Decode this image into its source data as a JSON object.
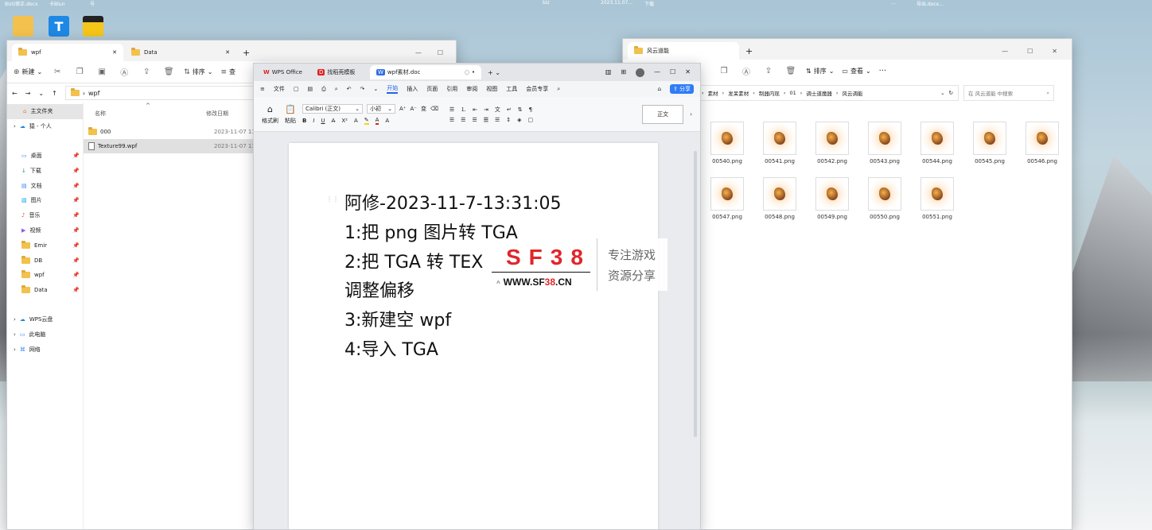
{
  "desktop": {
    "icons": [
      {
        "name": "folder",
        "color": "#f2c14e"
      },
      {
        "name": "T",
        "color": "#1e88e5"
      },
      {
        "name": "app",
        "color": "#f5c518"
      }
    ],
    "top_labels": [
      "BUG修正.docx",
      "卡Blun",
      "号",
      "biz",
      "2023.11.07...",
      "下载",
      "...",
      "导出.docx..."
    ]
  },
  "explorer_left": {
    "tabs": [
      {
        "label": "wpf"
      },
      {
        "label": "Data"
      }
    ],
    "new_tab": "+",
    "toolbar": {
      "new": "新建",
      "sort": "排序",
      "view": "查"
    },
    "path": "wpf",
    "sidebar": {
      "home": "主文件夹",
      "onedrive": "猿 - 个人",
      "quick": [
        {
          "label": "桌面",
          "icon": "desktop-icon"
        },
        {
          "label": "下载",
          "icon": "download-icon"
        },
        {
          "label": "文档",
          "icon": "document-icon"
        },
        {
          "label": "图片",
          "icon": "picture-icon"
        },
        {
          "label": "音乐",
          "icon": "music-icon"
        },
        {
          "label": "视频",
          "icon": "video-icon"
        },
        {
          "label": "Emir",
          "icon": "folder-icon"
        },
        {
          "label": "DB",
          "icon": "folder-icon"
        },
        {
          "label": "wpf",
          "icon": "folder-icon"
        },
        {
          "label": "Data",
          "icon": "folder-icon"
        }
      ],
      "locations": [
        {
          "label": "WPS云盘"
        },
        {
          "label": "此电脑"
        },
        {
          "label": "网络"
        }
      ]
    },
    "columns": {
      "name": "名称",
      "date": "修改日期"
    },
    "files": [
      {
        "name": "000",
        "date": "2023-11-07 13:3"
      },
      {
        "name": "Texture99.wpf",
        "date": "2023-11-07 13:2"
      }
    ]
  },
  "wps": {
    "tabs": [
      {
        "label": "WPS Office"
      },
      {
        "label": "找稻壳模板"
      },
      {
        "label": "wpf素材.doc"
      }
    ],
    "menu": [
      "文件",
      "开始",
      "插入",
      "页面",
      "引用",
      "审阅",
      "视图",
      "工具",
      "会员专享"
    ],
    "menu_active": "开始",
    "share": "分享",
    "ribbon": {
      "format_painter": "格式刷",
      "paste": "粘贴",
      "font": "Calibri (正文)",
      "size": "小初",
      "style_sample": "正文"
    },
    "doc_lines": [
      "阿修-2023-11-7-13:31:05",
      "1:把 png 图片转 TGA",
      "2:把 TGA 转 TEX",
      "调整偏移",
      "3:新建空 wpf",
      "4:导入 TGA"
    ],
    "watermark": {
      "brand": "SF38",
      "url_prefix": "WWW.SF",
      "url_num": "38",
      "url_suffix": ".CN",
      "slogan1": "专注游戏",
      "slogan2": "资源分享"
    }
  },
  "explorer_right": {
    "tab": "风云道能",
    "new_tab": "+",
    "toolbar": {
      "sort": "排序",
      "view": "查看"
    },
    "breadcrumb": [
      "素材",
      "发呆素材",
      "制器内现",
      "01",
      "调士道魔器",
      "风云调能"
    ],
    "search_placeholder": "在 风云道能 中搜索",
    "files": [
      {
        "name": "00540.png"
      },
      {
        "name": "00541.png"
      },
      {
        "name": "00542.png"
      },
      {
        "name": "00543.png"
      },
      {
        "name": "00544.png"
      },
      {
        "name": "00545.png"
      },
      {
        "name": "00546.png"
      },
      {
        "name": "00547.png"
      },
      {
        "name": "00548.png"
      },
      {
        "name": "00549.png"
      },
      {
        "name": "00550.png"
      },
      {
        "name": "00551.png"
      }
    ]
  }
}
